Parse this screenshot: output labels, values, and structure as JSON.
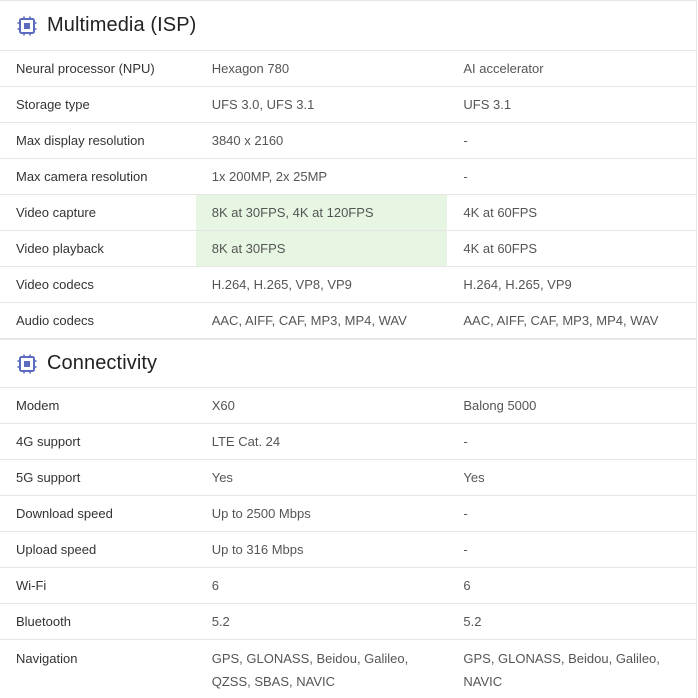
{
  "sections": [
    {
      "title": "Multimedia (ISP)",
      "icon": "chip-icon",
      "rows": [
        {
          "label": "Neural processor (NPU)",
          "v1": "Hexagon 780",
          "v2": "AI accelerator"
        },
        {
          "label": "Storage type",
          "v1": "UFS 3.0, UFS 3.1",
          "v2": "UFS 3.1"
        },
        {
          "label": "Max display resolution",
          "v1": "3840 x 2160",
          "v2": "-"
        },
        {
          "label": "Max camera resolution",
          "v1": "1x 200MP, 2x 25MP",
          "v2": "-"
        },
        {
          "label": "Video capture",
          "v1": "8K at 30FPS, 4K at 120FPS",
          "v2": "4K at 60FPS",
          "highlight": "v1"
        },
        {
          "label": "Video playback",
          "v1": "8K at 30FPS",
          "v2": "4K at 60FPS",
          "highlight": "v1"
        },
        {
          "label": "Video codecs",
          "v1": "H.264, H.265, VP8, VP9",
          "v2": "H.264, H.265, VP9"
        },
        {
          "label": "Audio codecs",
          "v1": "AAC, AIFF, CAF, MP3, MP4, WAV",
          "v2": "AAC, AIFF, CAF, MP3, MP4, WAV"
        }
      ]
    },
    {
      "title": "Connectivity",
      "icon": "chip-icon",
      "rows": [
        {
          "label": "Modem",
          "v1": "X60",
          "v2": "Balong 5000"
        },
        {
          "label": "4G support",
          "v1": "LTE Cat. 24",
          "v2": "-"
        },
        {
          "label": "5G support",
          "v1": "Yes",
          "v2": "Yes"
        },
        {
          "label": "Download speed",
          "v1": "Up to 2500 Mbps",
          "v2": "-"
        },
        {
          "label": "Upload speed",
          "v1": "Up to 316 Mbps",
          "v2": "-"
        },
        {
          "label": "Wi-Fi",
          "v1": "6",
          "v2": "6"
        },
        {
          "label": "Bluetooth",
          "v1": "5.2",
          "v2": "5.2"
        },
        {
          "label": "Navigation",
          "v1": "GPS, GLONASS, Beidou, Galileo, QZSS, SBAS, NAVIC",
          "v2": "GPS, GLONASS, Beidou, Galileo, NAVIC"
        }
      ]
    }
  ],
  "colors": {
    "highlight": "#e6f6e2",
    "icon": "#5b6bc0",
    "border": "#e6e6e6"
  }
}
